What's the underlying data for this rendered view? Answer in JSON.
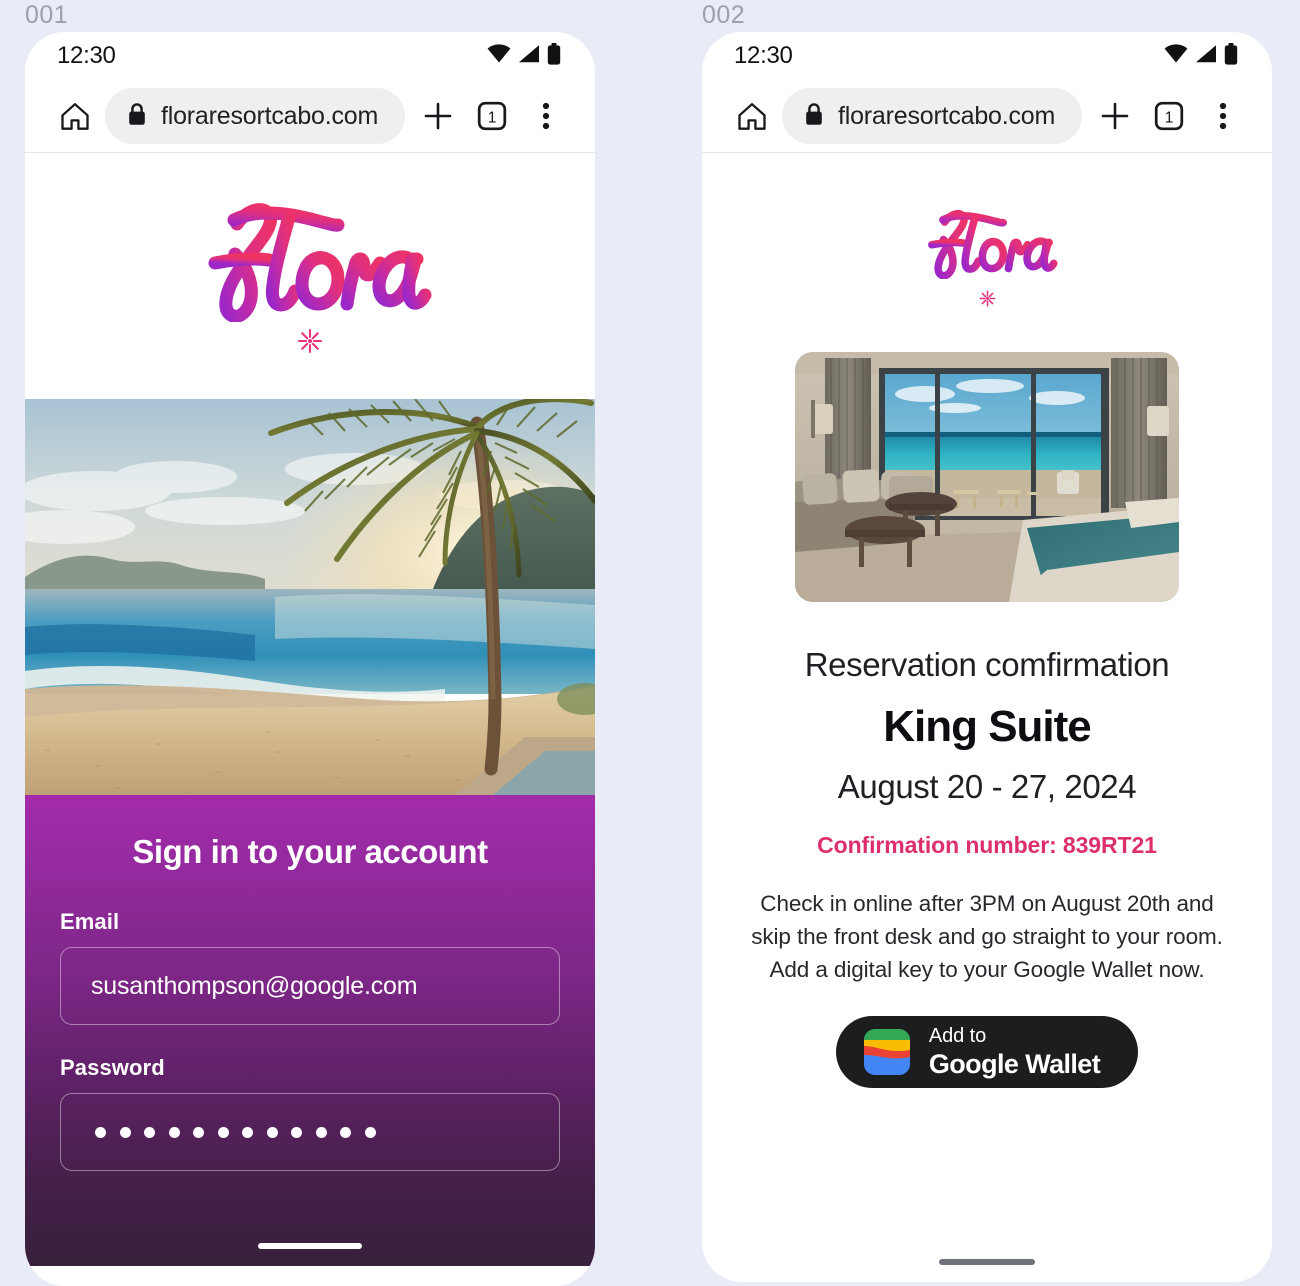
{
  "frames": [
    {
      "label": "001",
      "status": {
        "time": "12:30",
        "icons": [
          "wifi-icon",
          "signal-icon",
          "battery-icon"
        ]
      },
      "browser": {
        "home_icon": "home-icon",
        "lock_icon": "lock-icon",
        "url": "floraresortcabo.com",
        "new_tab_icon": "plus-icon",
        "tab_count": "1",
        "menu_icon": "more-vertical-icon"
      },
      "brand": {
        "name": "Flora",
        "mark": "asterisk-flower-icon"
      },
      "hero": {
        "alt": "tropical beach with palm tree at sunset"
      },
      "signin": {
        "title": "Sign in to your account",
        "email_label": "Email",
        "email_value": "susanthompson@google.com",
        "email_placeholder": "Email",
        "password_label": "Password",
        "password_masked_count": 12,
        "password_placeholder": "Password"
      }
    },
    {
      "label": "002",
      "status": {
        "time": "12:30",
        "icons": [
          "wifi-icon",
          "signal-icon",
          "battery-icon"
        ]
      },
      "browser": {
        "home_icon": "home-icon",
        "lock_icon": "lock-icon",
        "url": "floraresortcabo.com",
        "new_tab_icon": "plus-icon",
        "tab_count": "1",
        "menu_icon": "more-vertical-icon"
      },
      "brand": {
        "name": "Flora",
        "mark": "asterisk-flower-icon"
      },
      "photo": {
        "alt": "hotel suite interior with ocean view balcony"
      },
      "reservation": {
        "subtitle": "Reservation comfirmation",
        "room": "King Suite",
        "dates": "August 20 - 27, 2024",
        "confirmation": "Confirmation number: 839RT21",
        "note": "Check in online after 3PM on August 20th and skip the front desk and go straight to your room. Add a digital key to your Google Wallet now.",
        "wallet_button": {
          "line1": "Add to",
          "line2": "Google Wallet",
          "icon": "google-wallet-icon"
        }
      }
    }
  ],
  "colors": {
    "page_bg": "#e9ecf7",
    "brand_pink": "#e8337e",
    "brand_purple": "#a32bab",
    "confirmation_pink": "#dd2f6b",
    "panel_gradient_top": "#a32bab",
    "panel_gradient_bottom": "#38203c",
    "wallet_button_bg": "#1b1d1f",
    "urlbar_bg": "#efeff1"
  }
}
